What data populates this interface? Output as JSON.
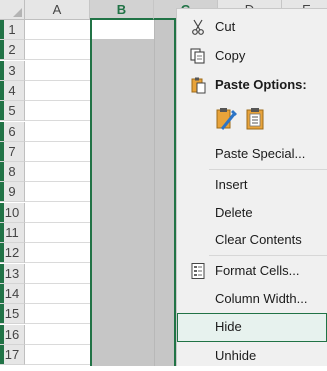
{
  "sheet": {
    "columns": [
      "A",
      "B",
      "C",
      "D",
      "E"
    ],
    "rows": [
      "1",
      "2",
      "3",
      "4",
      "5",
      "6",
      "7",
      "8",
      "9",
      "10",
      "11",
      "12",
      "13",
      "14",
      "15",
      "16",
      "17"
    ],
    "selected_columns": [
      "B",
      "C"
    ],
    "colors": {
      "accent": "#217346",
      "selection": "#c6c6c6",
      "header": "#e6e6e6"
    }
  },
  "context_menu": {
    "cut": "Cut",
    "copy": "Copy",
    "paste_options": "Paste Options:",
    "paste_special": "Paste Special...",
    "insert": "Insert",
    "delete": "Delete",
    "clear_contents": "Clear Contents",
    "format_cells": "Format Cells...",
    "column_width": "Column Width...",
    "hide": "Hide",
    "unhide": "Unhide",
    "highlighted": "Hide",
    "icons": [
      "scissors-icon",
      "copy-icon",
      "paste-icon",
      "paste-format-icon",
      "paste-values-icon",
      "format-cells-icon"
    ]
  }
}
